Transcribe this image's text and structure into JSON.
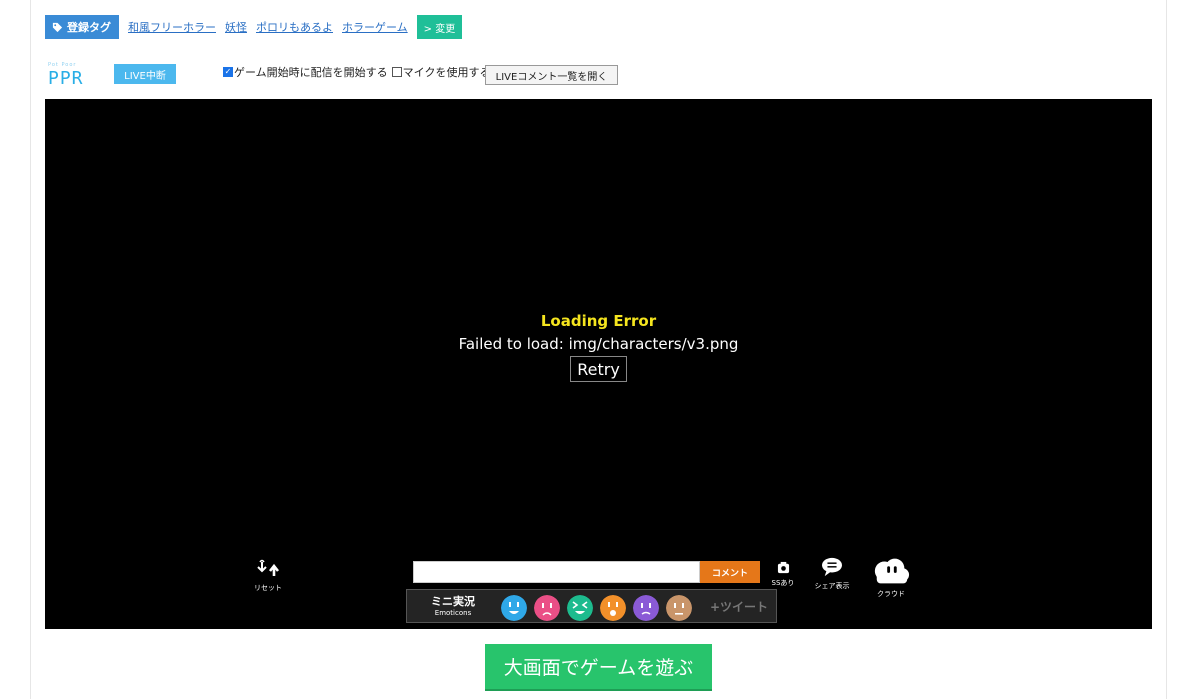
{
  "tags": {
    "label": "登録タグ",
    "links": [
      "和風フリーホラー",
      "妖怪",
      "ポロリもあるよ",
      "ホラーゲーム"
    ],
    "change_label": "> 変更"
  },
  "logo": {
    "sub": "Pot Poor",
    "main": "PPR"
  },
  "live_status": "LIVE中断",
  "options": {
    "start_broadcast": {
      "label": "ゲーム開始時に配信を開始する",
      "checked": true
    },
    "use_mic": {
      "label": "マイクを使用する",
      "checked": false
    }
  },
  "live_comments_button": "LIVEコメント一覧を開く",
  "error": {
    "title": "Loading Error",
    "message": "Failed to load: img/characters/v3.png",
    "retry": "Retry"
  },
  "controls": {
    "reset": "リセット",
    "comment_placeholder": "",
    "comment_button": "コメント",
    "screenshot": "SSあり",
    "share": "シェア表示",
    "cloud": "クラウド"
  },
  "emote_bar": {
    "title": "ミニ実況",
    "subtitle": "Emoticons",
    "emoticons": [
      "smile-face",
      "sad-face",
      "squint-face",
      "surprised-face",
      "worried-face",
      "neutral-face"
    ],
    "emoticon_colors": [
      "#2fa8e8",
      "#ea4f86",
      "#1dbb8e",
      "#f2902a",
      "#8a5ad6",
      "#c9956a"
    ],
    "tweet": "+ツイート"
  },
  "play_big_button": "大画面でゲームを遊ぶ",
  "colors": {
    "tag_blue": "#3a8bd6",
    "change_green": "#1fbf98",
    "live_blue": "#4cb8ee",
    "error_yellow": "#f5e51e",
    "comment_orange": "#e57719",
    "play_green": "#28c46c"
  }
}
